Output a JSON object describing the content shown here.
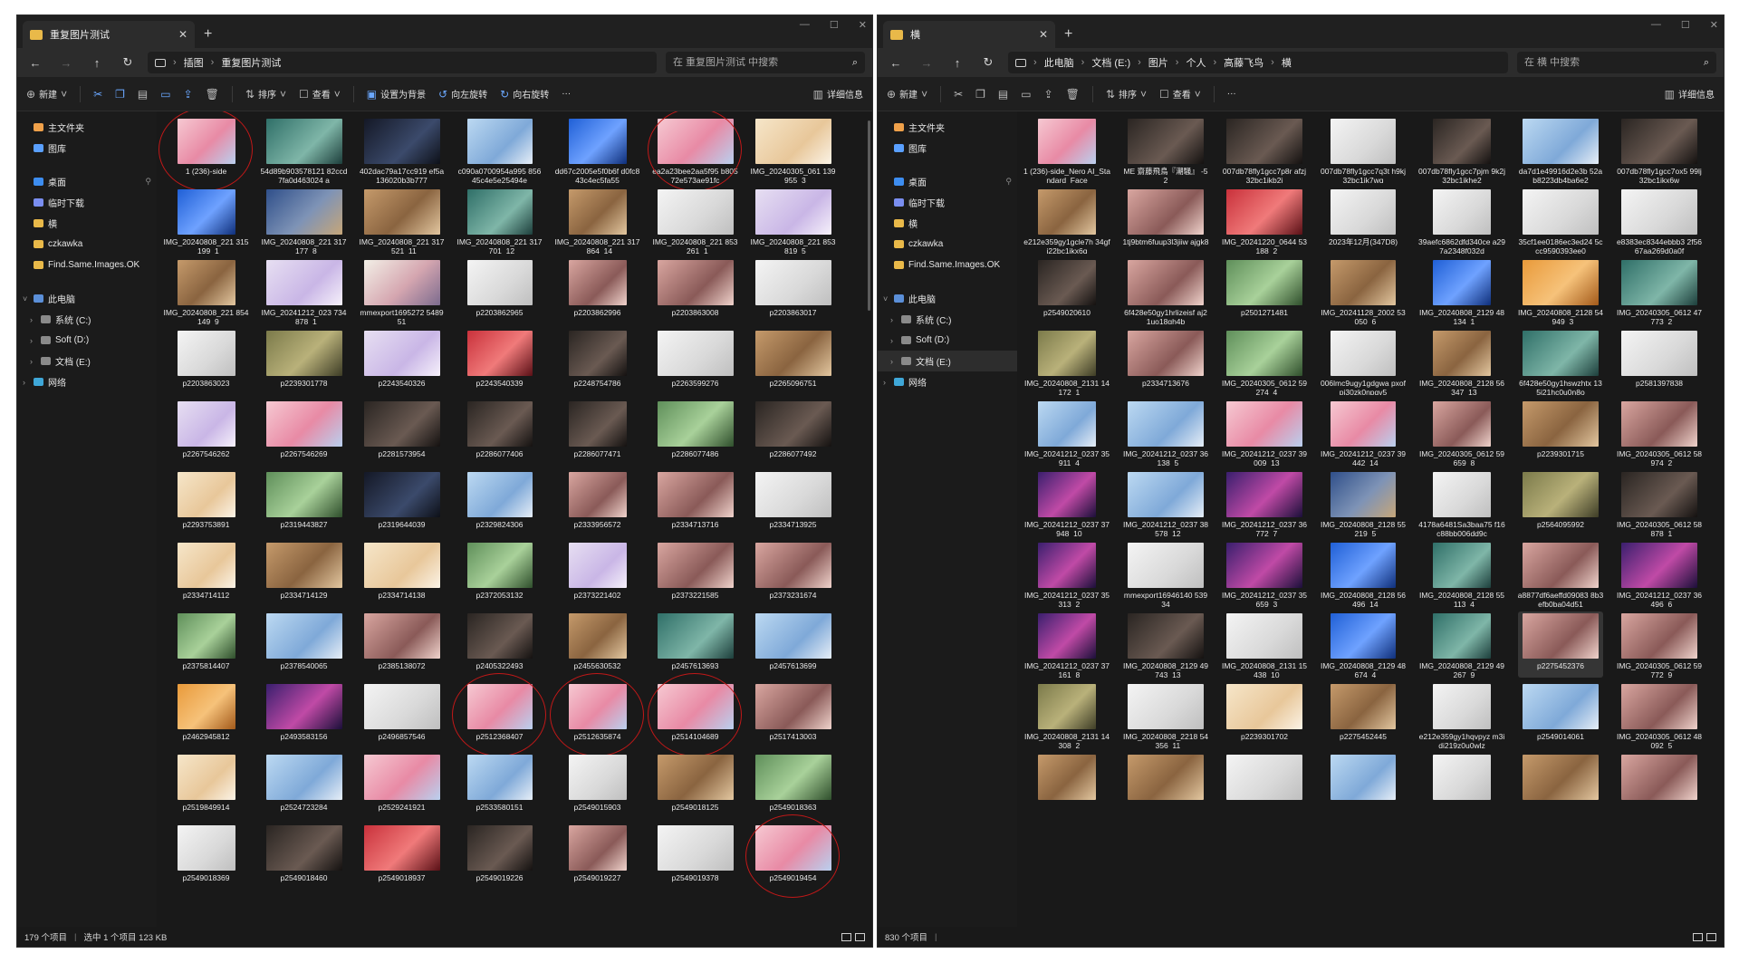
{
  "left": {
    "tab_title": "重复图片测试",
    "breadcrumb": [
      "插图",
      "重复图片测试"
    ],
    "search_placeholder": "在 重复图片测试 中搜索",
    "commands": {
      "new": "新建",
      "sort": "排序",
      "view": "查看",
      "set_background": "设置为背景",
      "rotate_left": "向左旋转",
      "rotate_right": "向右旋转",
      "more": "···",
      "details": "详细信息"
    },
    "nav": [
      {
        "label": "主文件夹",
        "icon": "home-icon",
        "kind": "home"
      },
      {
        "label": "图库",
        "icon": "gallery-icon",
        "kind": "gal"
      },
      {
        "label": "桌面",
        "icon": "desktop-icon",
        "kind": "desk",
        "gap": true
      },
      {
        "label": "临时下载",
        "icon": "download-icon",
        "kind": "dl"
      },
      {
        "label": "横",
        "icon": "folder-icon",
        "kind": "fold"
      },
      {
        "label": "czkawka",
        "icon": "folder-icon",
        "kind": "fold"
      },
      {
        "label": "Find.Same.Images.OK",
        "icon": "folder-icon",
        "kind": "fold"
      },
      {
        "label": "此电脑",
        "icon": "pc-icon",
        "kind": "pc",
        "gap": true,
        "expanded": true
      },
      {
        "label": "系统 (C:)",
        "icon": "drive-icon",
        "kind": "drive",
        "child": true
      },
      {
        "label": "Soft (D:)",
        "icon": "drive-icon",
        "kind": "drive",
        "child": true
      },
      {
        "label": "文档 (E:)",
        "icon": "drive-icon",
        "kind": "drive",
        "child": true
      },
      {
        "label": "网络",
        "icon": "network-icon",
        "kind": "net"
      }
    ],
    "status": {
      "count": "179 个项目",
      "selected": "选中 1 个项目  123 KB"
    },
    "items": [
      [
        "1 (236)-side",
        "pink"
      ],
      [
        "54d89b903578121 82ccd7fa0d463024 a",
        "teal"
      ],
      [
        "402dac79a17cc919 ef5a136020b3b777",
        "night"
      ],
      [
        "c090a0700954a995 85645c4e5e25494e",
        "sky"
      ],
      [
        "dd67c2005e5f0b6f d0fc843c4ec5fa55",
        "blue"
      ],
      [
        "ea2a23bee2aa5f95 b80572e573ae91fc",
        "pink"
      ],
      [
        "IMG_20240305_061 139_955_3",
        "cream"
      ],
      [
        "IMG_20240808_221 315_199_1",
        "blue"
      ],
      [
        "IMG_20240808_221 317_177_8",
        "denim"
      ],
      [
        "IMG_20240808_221 317_521_11",
        "tan"
      ],
      [
        "IMG_20240808_221 317_701_12",
        "teal"
      ],
      [
        "IMG_20240808_221 317_864_14",
        "tan"
      ],
      [
        "IMG_20240808_221 853_261_1",
        "white"
      ],
      [
        "IMG_20240808_221 853_819_5",
        "lilac"
      ],
      [
        "IMG_20240808_221 854_149_9",
        "tan"
      ],
      [
        "IMG_20241212_023 734_878_1",
        "lilac"
      ],
      [
        "mmexport1695272 548951",
        "poster"
      ],
      [
        "p2203862965",
        "white"
      ],
      [
        "p2203862996",
        "rose"
      ],
      [
        "p2203863008",
        "rose"
      ],
      [
        "p2203863017",
        "white"
      ],
      [
        "p2203863023",
        "white"
      ],
      [
        "p2239301778",
        "olive"
      ],
      [
        "p2243540326",
        "lilac"
      ],
      [
        "p2243540339",
        "red"
      ],
      [
        "p2248754786",
        "dark"
      ],
      [
        "p2263599276",
        "white"
      ],
      [
        "p2265096751",
        "tan"
      ],
      [
        "p2267546262",
        "lilac"
      ],
      [
        "p2267546269",
        "pink"
      ],
      [
        "p2281573954",
        "dark"
      ],
      [
        "p2286077406",
        "dark"
      ],
      [
        "p2286077471",
        "dark"
      ],
      [
        "p2286077486",
        "green"
      ],
      [
        "p2286077492",
        "dark"
      ],
      [
        "p2293753891",
        "cream"
      ],
      [
        "p2319443827",
        "green"
      ],
      [
        "p2319644039",
        "night"
      ],
      [
        "p2329824306",
        "sky"
      ],
      [
        "p2333956572",
        "rose"
      ],
      [
        "p2334713716",
        "rose"
      ],
      [
        "p2334713925",
        "white"
      ],
      [
        "p2334714112",
        "cream"
      ],
      [
        "p2334714129",
        "tan"
      ],
      [
        "p2334714138",
        "cream"
      ],
      [
        "p2372053132",
        "green"
      ],
      [
        "p2373221402",
        "lilac"
      ],
      [
        "p2373221585",
        "rose"
      ],
      [
        "p2373231674",
        "rose"
      ],
      [
        "p2375814407",
        "green"
      ],
      [
        "p2378540065",
        "sky"
      ],
      [
        "p2385138072",
        "rose"
      ],
      [
        "p2405322493",
        "dark"
      ],
      [
        "p2455630532",
        "tan"
      ],
      [
        "p2457613693",
        "teal"
      ],
      [
        "p2457613699",
        "sky"
      ],
      [
        "p2462945812",
        "orange"
      ],
      [
        "p2493583156",
        "purple"
      ],
      [
        "p2496857546",
        "white"
      ],
      [
        "p2512368407",
        "pink"
      ],
      [
        "p2512635874",
        "pink"
      ],
      [
        "p2514104689",
        "pink"
      ],
      [
        "p2517413003",
        "rose"
      ],
      [
        "p2519849914",
        "cream"
      ],
      [
        "p2524723284",
        "sky"
      ],
      [
        "p2529241921",
        "pink"
      ],
      [
        "p2533580151",
        "sky"
      ],
      [
        "p2549015903",
        "white"
      ],
      [
        "p2549018125",
        "tan"
      ],
      [
        "p2549018363",
        "green"
      ],
      [
        "p2549018369",
        "white"
      ],
      [
        "p2549018460",
        "dark"
      ],
      [
        "p2549018937",
        "red"
      ],
      [
        "p2549019226",
        "dark"
      ],
      [
        "p2549019227",
        "rose"
      ],
      [
        "p2549019378",
        "white"
      ],
      [
        "p2549019454",
        "pink"
      ]
    ]
  },
  "right": {
    "tab_title": "横",
    "breadcrumb": [
      "此电脑",
      "文档 (E:)",
      "图片",
      "个人",
      "高藤飞鸟",
      "横"
    ],
    "search_placeholder": "在 横 中搜索",
    "commands": {
      "new": "新建",
      "sort": "排序",
      "view": "查看",
      "more": "···",
      "details": "详细信息"
    },
    "nav": [
      {
        "label": "主文件夹",
        "icon": "home-icon",
        "kind": "home"
      },
      {
        "label": "图库",
        "icon": "gallery-icon",
        "kind": "gal"
      },
      {
        "label": "桌面",
        "icon": "desktop-icon",
        "kind": "desk",
        "gap": true
      },
      {
        "label": "临时下载",
        "icon": "download-icon",
        "kind": "dl"
      },
      {
        "label": "横",
        "icon": "folder-icon",
        "kind": "fold"
      },
      {
        "label": "czkawka",
        "icon": "folder-icon",
        "kind": "fold"
      },
      {
        "label": "Find.Same.Images.OK",
        "icon": "folder-icon",
        "kind": "fold"
      },
      {
        "label": "此电脑",
        "icon": "pc-icon",
        "kind": "pc",
        "gap": true,
        "expanded": true
      },
      {
        "label": "系统 (C:)",
        "icon": "drive-icon",
        "kind": "drive",
        "child": true
      },
      {
        "label": "Soft (D:)",
        "icon": "drive-icon",
        "kind": "drive",
        "child": true
      },
      {
        "label": "文档 (E:)",
        "icon": "drive-icon",
        "kind": "drive",
        "child": true,
        "selected": true
      },
      {
        "label": "网络",
        "icon": "network-icon",
        "kind": "net"
      }
    ],
    "status": {
      "count": "830 个项目"
    },
    "items": [
      [
        "1 (236)-side_Nero AI_Standard_Face",
        "pink"
      ],
      [
        "ME 齋藤飛鳥『潮騒』 -52",
        "dark"
      ],
      [
        "007db78fly1gcc7p8r afzj32bc1jkb2j",
        "dark"
      ],
      [
        "007db78fly1gcc7q3t h9kj32bc1jk7wq",
        "white"
      ],
      [
        "007db78fly1gcc7pjm 9k2j32bc1jkhe2",
        "dark"
      ],
      [
        "da7d1e49916d2e3b 52ab8223db4ba6e2",
        "sky"
      ],
      [
        "007db78fly1gcc7ox5 99lj32bc1jkx6w",
        "dark"
      ],
      [
        "e212e359gy1gcle7h 34gfj22bc1jkx6q",
        "tan"
      ],
      [
        "1tj9btm6fuup3l3jiiw ajgk8",
        "rose"
      ],
      [
        "IMG_20241220_0644 53_188_2",
        "red"
      ],
      [
        "2023年12月(347D8)",
        "white"
      ],
      [
        "39aefc6862dfd340ce a297a2348f032d",
        "white"
      ],
      [
        "35cf1ee0186ec3ed24 5ccc9590393ee0",
        "white"
      ],
      [
        "e8383ec8344ebbb3 2f5667aa269d0a0f",
        "white"
      ],
      [
        "p2549020610",
        "dark"
      ],
      [
        "6f428e50gy1hrlizeisf aj21uo18gh4b",
        "rose"
      ],
      [
        "p2501271481",
        "green"
      ],
      [
        "IMG_20241128_2002 53_050_6",
        "tan"
      ],
      [
        "IMG_20240808_2129 48_134_1",
        "blue"
      ],
      [
        "IMG_20240808_2128 54_949_3",
        "orange"
      ],
      [
        "IMG_20240305_0612 47_773_2",
        "teal"
      ],
      [
        "IMG_20240808_2131 14_172_1",
        "olive"
      ],
      [
        "p2334713676",
        "rose"
      ],
      [
        "IMG_20240305_0612 59_274_4",
        "green"
      ],
      [
        "006lmc9ugy1gdgwa pxofpj30zk0npqv5",
        "white"
      ],
      [
        "IMG_20240808_2128 56_347_13",
        "tan"
      ],
      [
        "6f428e50gy1hswzhtx 135j21hc0u0n8o",
        "teal"
      ],
      [
        "p2581397838",
        "white"
      ],
      [
        "IMG_20241212_0237 35_911_4",
        "sky"
      ],
      [
        "IMG_20241212_0237 36_138_5",
        "sky"
      ],
      [
        "IMG_20241212_0237 39_009_13",
        "pink"
      ],
      [
        "IMG_20241212_0237 39_442_14",
        "pink"
      ],
      [
        "IMG_20240305_0612 59_659_8",
        "rose"
      ],
      [
        "p2239301715",
        "tan"
      ],
      [
        "IMG_20240305_0612 58_974_2",
        "rose"
      ],
      [
        "IMG_20241212_0237 37_948_10",
        "purple"
      ],
      [
        "IMG_20241212_0237 38_578_12",
        "sky"
      ],
      [
        "IMG_20241212_0237 36_772_7",
        "purple"
      ],
      [
        "IMG_20240808_2128 55_219_5",
        "denim"
      ],
      [
        "4178a6481Sa3baa75 f16c88bb006dd9c",
        "white"
      ],
      [
        "p2564095992",
        "olive"
      ],
      [
        "IMG_20240305_0612 58_878_1",
        "dark"
      ],
      [
        "IMG_20241212_0237 35_313_2",
        "purple"
      ],
      [
        "mmexport16946140 53934",
        "white"
      ],
      [
        "IMG_20241212_0237 35_659_3",
        "purple"
      ],
      [
        "IMG_20240808_2128 56_496_14",
        "blue"
      ],
      [
        "IMG_20240808_2128 55_113_4",
        "teal"
      ],
      [
        "a8877df6aeffd09083 8b3efb0ba04d51",
        "rose"
      ],
      [
        "IMG_20241212_0237 36_496_6",
        "purple"
      ],
      [
        "IMG_20241212_0237 37_161_8",
        "purple"
      ],
      [
        "IMG_20240808_2129 49_743_13",
        "dark"
      ],
      [
        "IMG_20240808_2131 15_438_10",
        "white"
      ],
      [
        "IMG_20240808_2129 48_674_4",
        "blue"
      ],
      [
        "IMG_20240808_2129 49_267_9",
        "teal"
      ],
      [
        "p2275452376",
        "rose"
      ],
      [
        "IMG_20240305_0612 59_772_9",
        "rose"
      ],
      [
        "IMG_20240808_2131 14_308_2",
        "olive"
      ],
      [
        "IMG_20240808_2218 54_356_11",
        "white"
      ],
      [
        "p2239301702",
        "cream"
      ],
      [
        "p2275452445",
        "tan"
      ],
      [
        "e212e359gy1hqvpyz m3idj219z0u0wlz",
        "white"
      ],
      [
        "p2549014061",
        "sky"
      ],
      [
        "IMG_20240305_0612 48_092_5",
        "rose"
      ],
      [
        "",
        "tan"
      ],
      [
        "",
        "tan"
      ],
      [
        "",
        "white"
      ],
      [
        "",
        "sky"
      ],
      [
        "",
        "white"
      ],
      [
        "",
        "tan"
      ],
      [
        "",
        "rose"
      ]
    ]
  },
  "palette": {
    "pink": "linear-gradient(135deg,#f6c9d2,#e88aa5 55%,#b9d0ef)",
    "teal": "linear-gradient(135deg,#2f6f68,#7fb6a8 60%,#1d3f3c)",
    "night": "linear-gradient(135deg,#141826,#3b4a6b 60%,#0d1018)",
    "sky": "linear-gradient(135deg,#bcd9f2,#7fa9d8 60%,#e6eef7)",
    "blue": "linear-gradient(135deg,#1f5fd6,#6fa2ff 55%,#0f2f7a)",
    "cream": "linear-gradient(135deg,#f6e6c9,#e8c79a 60%,#fbf3e6)",
    "denim": "linear-gradient(135deg,#2f4f8a,#7e93b6 55%,#c6a679)",
    "tan": "linear-gradient(135deg,#c59a6b,#8a6440 55%,#e3c7a0)",
    "white": "linear-gradient(135deg,#f4f4f4,#d9d9d9 60%,#bfbfbf)",
    "lilac": "linear-gradient(135deg,#e7dff2,#c9b6e6 60%,#f6f1fb)",
    "poster": "linear-gradient(135deg,#f3f0e7,#d5a6b0 55%,#7c6b8e)",
    "rose": "linear-gradient(135deg,#d9a6a0,#8a5a58 60%,#f0d3cc)",
    "olive": "linear-gradient(135deg,#7b7a4a,#b9b17a 55%,#3e3d26)",
    "red": "linear-gradient(135deg,#c9313b,#f07a7a 55%,#5a1016)",
    "dark": "linear-gradient(135deg,#2a2522,#6a5a52 60%,#141110)",
    "green": "linear-gradient(135deg,#5f8f5a,#a9d19a 55%,#2f4f2c)",
    "orange": "linear-gradient(135deg,#e99a3a,#f6c27a 55%,#a35a1a)",
    "purple": "linear-gradient(135deg,#3a1f6e,#c04aa6 55%,#1b0f3a)"
  },
  "accent": "#c01818"
}
